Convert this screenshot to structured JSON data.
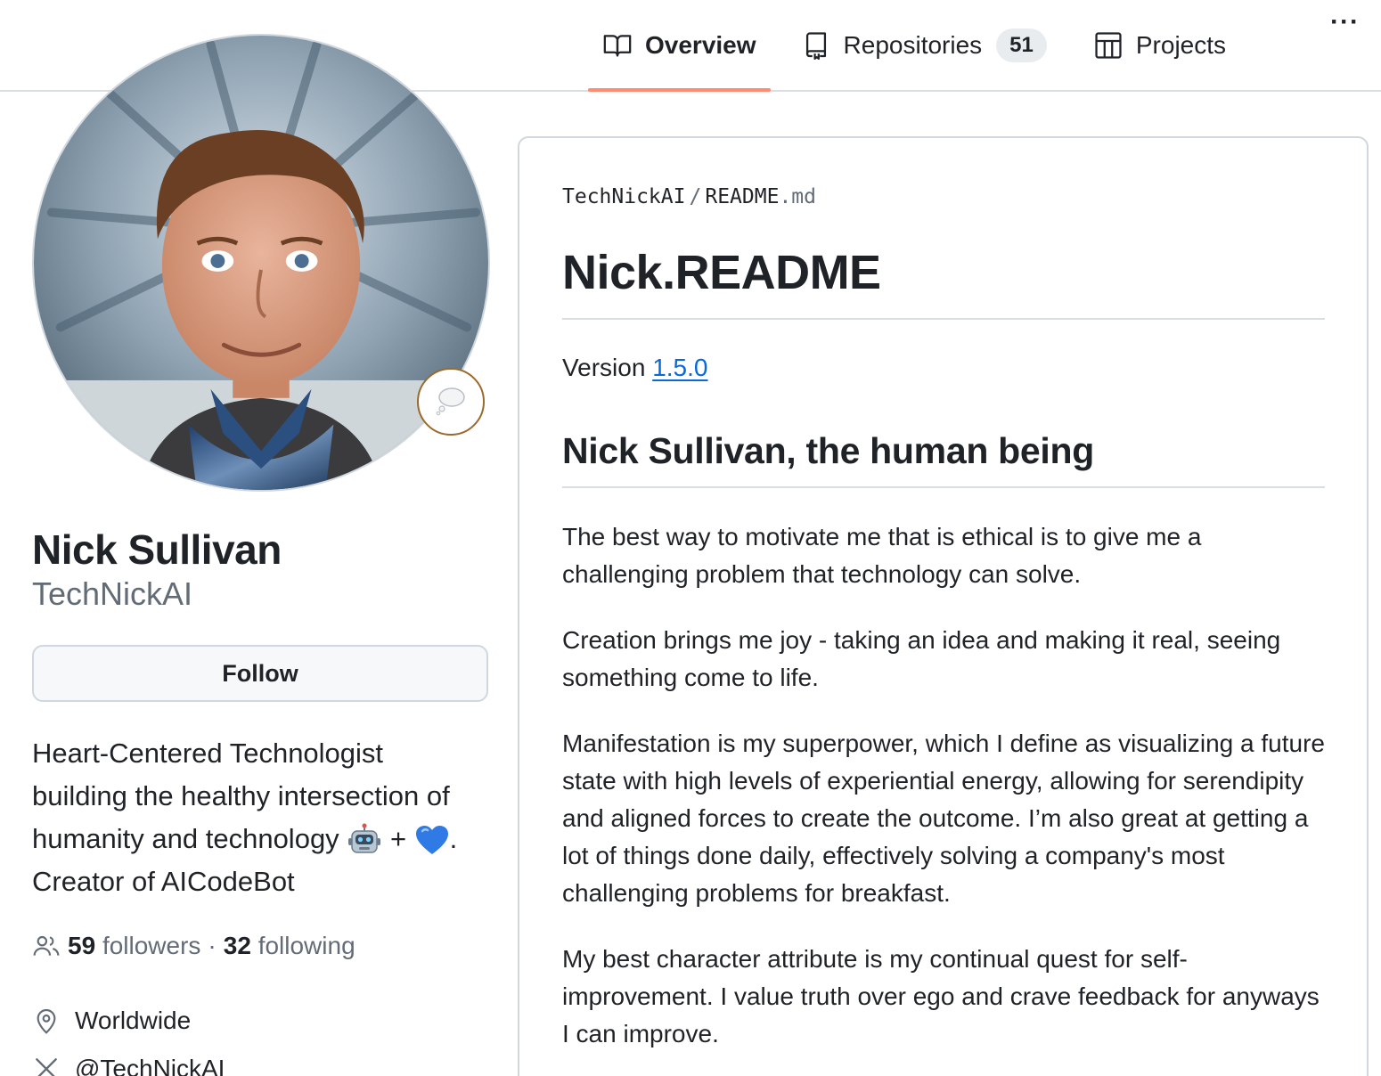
{
  "tabs": {
    "overview": "Overview",
    "repositories": "Repositories",
    "repositories_count": "51",
    "projects": "Projects",
    "more": "···"
  },
  "profile": {
    "full_name": "Nick Sullivan",
    "username": "TechNickAI",
    "follow_label": "Follow",
    "bio_line1": "Heart-Centered Technologist",
    "bio_line2": "building the healthy intersection of",
    "bio_line3_a": "humanity and technology",
    "bio_line3_plus": "+",
    "bio_line3_end": ".",
    "bio_line4": "Creator of AICodeBot",
    "followers_count": "59",
    "followers_label": "followers",
    "dot": "·",
    "following_count": "32",
    "following_label": "following",
    "location": "Worldwide",
    "x_handle": "@TechNickAI"
  },
  "readme": {
    "owner": "TechNickAI",
    "separator": "/",
    "file_base": "README",
    "file_ext": ".md",
    "title": "Nick.README",
    "version_prefix": "Version",
    "version_link": "1.5.0",
    "section_heading": "Nick Sullivan, the human being",
    "p1": "The best way to motivate me that is ethical is to give me a challenging problem that technology can solve.",
    "p2": "Creation brings me joy - taking an idea and making it real, seeing something come to life.",
    "p3": "Manifestation is my superpower, which I define as visualizing a future state with high levels of experiential energy, allowing for serendipity and aligned forces to create the outcome. I’m also great at getting a lot of things done daily, effectively solving a company's most challenging problems for breakfast.",
    "p4": "My best character attribute is my continual quest for self-improvement. I value truth over ego and crave feedback for anyways I can improve."
  },
  "colors": {
    "accent_underline": "#fd8c73",
    "link": "#0969da",
    "muted": "#636c76",
    "border": "#d0d7de"
  },
  "icons": {
    "overview": "book-icon",
    "repositories": "repo-icon",
    "projects": "table-icon",
    "followers": "people-icon",
    "location": "location-pin-icon",
    "x": "x-logo-icon",
    "status": "thought-bubble-icon",
    "bio_emoji_1": "robot-emoji",
    "bio_emoji_2": "blue-heart-emoji"
  }
}
